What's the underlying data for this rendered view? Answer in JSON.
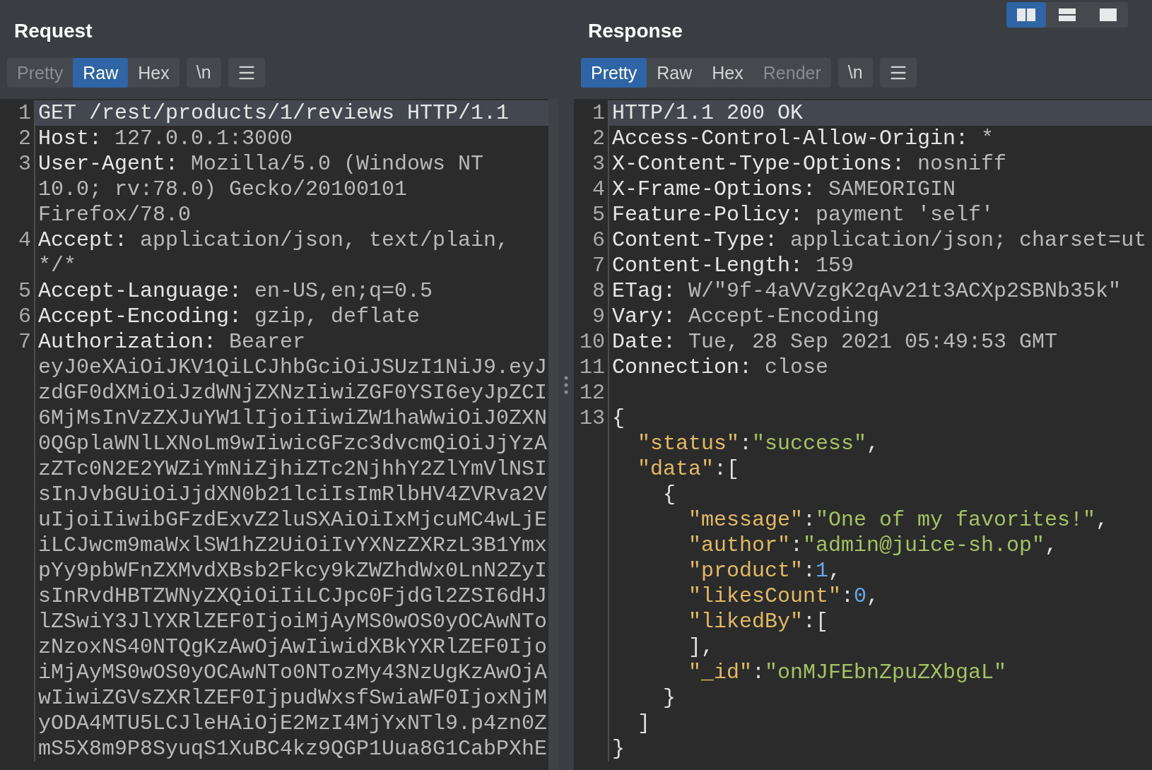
{
  "view_buttons": [
    {
      "kind": "columns",
      "selected": true
    },
    {
      "kind": "rows",
      "selected": false
    },
    {
      "kind": "single",
      "selected": false
    }
  ],
  "request": {
    "title": "Request",
    "tabs": [
      {
        "label": "Pretty",
        "selected": false,
        "disabled": true
      },
      {
        "label": "Raw",
        "selected": true,
        "disabled": false
      },
      {
        "label": "Hex",
        "selected": false,
        "disabled": false
      }
    ],
    "newline_button": "\\n",
    "lines": [
      {
        "number": "1",
        "selected": true,
        "parts": [
          {
            "kind": "name",
            "text": "GET /rest/products/1/reviews HTTP/1.1"
          }
        ]
      },
      {
        "number": "2",
        "selected": false,
        "parts": [
          {
            "kind": "name",
            "text": "Host:"
          },
          {
            "kind": "value",
            "text": " 127.0.0.1:3000"
          }
        ]
      },
      {
        "number": "3",
        "selected": false,
        "parts": [
          {
            "kind": "name",
            "text": "User-Agent:"
          },
          {
            "kind": "value",
            "text": " Mozilla/5.0 (Windows NT"
          }
        ]
      },
      {
        "selected": false,
        "parts": [
          {
            "kind": "value",
            "text": "10.0; rv:78.0) Gecko/20100101"
          }
        ]
      },
      {
        "selected": false,
        "parts": [
          {
            "kind": "value",
            "text": "Firefox/78.0"
          }
        ]
      },
      {
        "number": "4",
        "selected": false,
        "parts": [
          {
            "kind": "name",
            "text": "Accept:"
          },
          {
            "kind": "value",
            "text": " application/json, text/plain,"
          }
        ]
      },
      {
        "selected": false,
        "parts": [
          {
            "kind": "value",
            "text": "*/*"
          }
        ]
      },
      {
        "number": "5",
        "selected": false,
        "parts": [
          {
            "kind": "name",
            "text": "Accept-Language:"
          },
          {
            "kind": "value",
            "text": " en-US,en;q=0.5"
          }
        ]
      },
      {
        "number": "6",
        "selected": false,
        "parts": [
          {
            "kind": "name",
            "text": "Accept-Encoding:"
          },
          {
            "kind": "value",
            "text": " gzip, deflate"
          }
        ]
      },
      {
        "number": "7",
        "selected": false,
        "parts": [
          {
            "kind": "name",
            "text": "Authorization:"
          },
          {
            "kind": "value",
            "text": " Bearer"
          }
        ]
      },
      {
        "selected": false,
        "parts": [
          {
            "kind": "value",
            "text": "eyJ0eXAiOiJKV1QiLCJhbGciOiJSUzI1NiJ9.eyJ"
          }
        ]
      },
      {
        "selected": false,
        "parts": [
          {
            "kind": "value",
            "text": "zdGF0dXMiOiJzdWNjZXNzIiwiZGF0YSI6eyJpZCI"
          }
        ]
      },
      {
        "selected": false,
        "parts": [
          {
            "kind": "value",
            "text": "6MjMsInVzZXJuYW1lIjoiIiwiZW1haWwiOiJ0ZXN"
          }
        ]
      },
      {
        "selected": false,
        "parts": [
          {
            "kind": "value",
            "text": "0QGplaWNlLXNoLm9wIiwicGFzc3dvcmQiOiJjYzA"
          }
        ]
      },
      {
        "selected": false,
        "parts": [
          {
            "kind": "value",
            "text": "zZTc0N2E2YWZiYmNiZjhiZTc2NjhhY2ZlYmVlNSI"
          }
        ]
      },
      {
        "selected": false,
        "parts": [
          {
            "kind": "value",
            "text": "sInJvbGUiOiJjdXN0b21lciIsImRlbHV4ZVRva2V"
          }
        ]
      },
      {
        "selected": false,
        "parts": [
          {
            "kind": "value",
            "text": "uIjoiIiwibGFzdExvZ2luSXAiOiIxMjcuMC4wLjE"
          }
        ]
      },
      {
        "selected": false,
        "parts": [
          {
            "kind": "value",
            "text": "iLCJwcm9maWxlSW1hZ2UiOiIvYXNzZXRzL3B1Ymx"
          }
        ]
      },
      {
        "selected": false,
        "parts": [
          {
            "kind": "value",
            "text": "pYy9pbWFnZXMvdXBsb2Fkcy9kZWZhdWx0LnN2ZyI"
          }
        ]
      },
      {
        "selected": false,
        "parts": [
          {
            "kind": "value",
            "text": "sInRvdHBTZWNyZXQiOiIiLCJpc0FjdGl2ZSI6dHJ"
          }
        ]
      },
      {
        "selected": false,
        "parts": [
          {
            "kind": "value",
            "text": "lZSwiY3JlYXRlZEF0IjoiMjAyMS0wOS0yOCAwNTo"
          }
        ]
      },
      {
        "selected": false,
        "parts": [
          {
            "kind": "value",
            "text": "zNzoxNS40NTQgKzAwOjAwIiwidXBkYXRlZEF0Ijo"
          }
        ]
      },
      {
        "selected": false,
        "parts": [
          {
            "kind": "value",
            "text": "iMjAyMS0wOS0yOCAwNTo0NTozMy43NzUgKzAwOjA"
          }
        ]
      },
      {
        "selected": false,
        "parts": [
          {
            "kind": "value",
            "text": "wIiwiZGVsZXRlZEF0IjpudWxsfSwiaWF0IjoxNjM"
          }
        ]
      },
      {
        "selected": false,
        "parts": [
          {
            "kind": "value",
            "text": "yODA4MTU5LCJleHAiOjE2MzI4MjYxNTl9.p4zn0Z"
          }
        ]
      },
      {
        "selected": false,
        "parts": [
          {
            "kind": "value",
            "text": "mS5X8m9P8SyuqS1XuBC4kz9QGP1Uua8G1CabPXhE"
          }
        ]
      }
    ]
  },
  "response": {
    "title": "Response",
    "tabs": [
      {
        "label": "Pretty",
        "selected": true,
        "disabled": false
      },
      {
        "label": "Raw",
        "selected": false,
        "disabled": false
      },
      {
        "label": "Hex",
        "selected": false,
        "disabled": false
      },
      {
        "label": "Render",
        "selected": false,
        "disabled": true
      }
    ],
    "newline_button": "\\n",
    "lines": [
      {
        "number": "1",
        "selected": true,
        "parts": [
          {
            "kind": "name",
            "text": "HTTP/1.1 200 OK"
          }
        ]
      },
      {
        "number": "2",
        "selected": false,
        "parts": [
          {
            "kind": "name",
            "text": "Access-Control-Allow-Origin:"
          },
          {
            "kind": "value",
            "text": " *"
          }
        ]
      },
      {
        "number": "3",
        "selected": false,
        "parts": [
          {
            "kind": "name",
            "text": "X-Content-Type-Options:"
          },
          {
            "kind": "value",
            "text": " nosniff"
          }
        ]
      },
      {
        "number": "4",
        "selected": false,
        "parts": [
          {
            "kind": "name",
            "text": "X-Frame-Options:"
          },
          {
            "kind": "value",
            "text": " SAMEORIGIN"
          }
        ]
      },
      {
        "number": "5",
        "selected": false,
        "parts": [
          {
            "kind": "name",
            "text": "Feature-Policy:"
          },
          {
            "kind": "value",
            "text": " payment 'self'"
          }
        ]
      },
      {
        "number": "6",
        "selected": false,
        "parts": [
          {
            "kind": "name",
            "text": "Content-Type:"
          },
          {
            "kind": "value",
            "text": " application/json; charset=ut"
          }
        ]
      },
      {
        "number": "7",
        "selected": false,
        "parts": [
          {
            "kind": "name",
            "text": "Content-Length:"
          },
          {
            "kind": "value",
            "text": " 159"
          }
        ]
      },
      {
        "number": "8",
        "selected": false,
        "parts": [
          {
            "kind": "name",
            "text": "ETag:"
          },
          {
            "kind": "value",
            "text": " W/\"9f-4aVVzgK2qAv21t3ACXp2SBNb35k\""
          }
        ]
      },
      {
        "number": "9",
        "selected": false,
        "parts": [
          {
            "kind": "name",
            "text": "Vary:"
          },
          {
            "kind": "value",
            "text": " Accept-Encoding"
          }
        ]
      },
      {
        "number": "10",
        "selected": false,
        "parts": [
          {
            "kind": "name",
            "text": "Date:"
          },
          {
            "kind": "value",
            "text": " Tue, 28 Sep 2021 05:49:53 GMT"
          }
        ]
      },
      {
        "number": "11",
        "selected": false,
        "parts": [
          {
            "kind": "name",
            "text": "Connection:"
          },
          {
            "kind": "value",
            "text": " close"
          }
        ]
      },
      {
        "number": "12",
        "selected": false
      },
      {
        "number": "13",
        "selected": false,
        "parts": [
          {
            "kind": "punct",
            "text": "{"
          }
        ]
      },
      {
        "selected": false,
        "parts": [
          {
            "kind": "key",
            "text": "  \"status\""
          },
          {
            "kind": "punct",
            "text": ":"
          },
          {
            "kind": "string",
            "text": "\"success\""
          },
          {
            "kind": "punct",
            "text": ","
          }
        ]
      },
      {
        "selected": false,
        "parts": [
          {
            "kind": "key",
            "text": "  \"data\""
          },
          {
            "kind": "punct",
            "text": ":["
          }
        ]
      },
      {
        "selected": false,
        "parts": [
          {
            "kind": "punct",
            "text": "    {"
          }
        ]
      },
      {
        "selected": false,
        "parts": [
          {
            "kind": "key",
            "text": "      \"message\""
          },
          {
            "kind": "punct",
            "text": ":"
          },
          {
            "kind": "string",
            "text": "\"One of my favorites!\""
          },
          {
            "kind": "punct",
            "text": ","
          }
        ]
      },
      {
        "selected": false,
        "parts": [
          {
            "kind": "key",
            "text": "      \"author\""
          },
          {
            "kind": "punct",
            "text": ":"
          },
          {
            "kind": "string",
            "text": "\"admin@juice-sh.op\""
          },
          {
            "kind": "punct",
            "text": ","
          }
        ]
      },
      {
        "selected": false,
        "parts": [
          {
            "kind": "key",
            "text": "      \"product\""
          },
          {
            "kind": "punct",
            "text": ":"
          },
          {
            "kind": "number",
            "text": "1"
          },
          {
            "kind": "punct",
            "text": ","
          }
        ]
      },
      {
        "selected": false,
        "parts": [
          {
            "kind": "key",
            "text": "      \"likesCount\""
          },
          {
            "kind": "punct",
            "text": ":"
          },
          {
            "kind": "number",
            "text": "0"
          },
          {
            "kind": "punct",
            "text": ","
          }
        ]
      },
      {
        "selected": false,
        "parts": [
          {
            "kind": "key",
            "text": "      \"likedBy\""
          },
          {
            "kind": "punct",
            "text": ":["
          }
        ]
      },
      {
        "selected": false,
        "parts": [
          {
            "kind": "punct",
            "text": "      ],"
          }
        ]
      },
      {
        "selected": false,
        "parts": [
          {
            "kind": "key",
            "text": "      \"_id\""
          },
          {
            "kind": "punct",
            "text": ":"
          },
          {
            "kind": "string",
            "text": "\"onMJFEbnZpuZXbgaL\""
          }
        ]
      },
      {
        "selected": false,
        "parts": [
          {
            "kind": "punct",
            "text": "    }"
          }
        ]
      },
      {
        "selected": false,
        "parts": [
          {
            "kind": "punct",
            "text": "  ]"
          }
        ]
      },
      {
        "selected": false,
        "parts": [
          {
            "kind": "punct",
            "text": "}"
          }
        ]
      }
    ]
  }
}
